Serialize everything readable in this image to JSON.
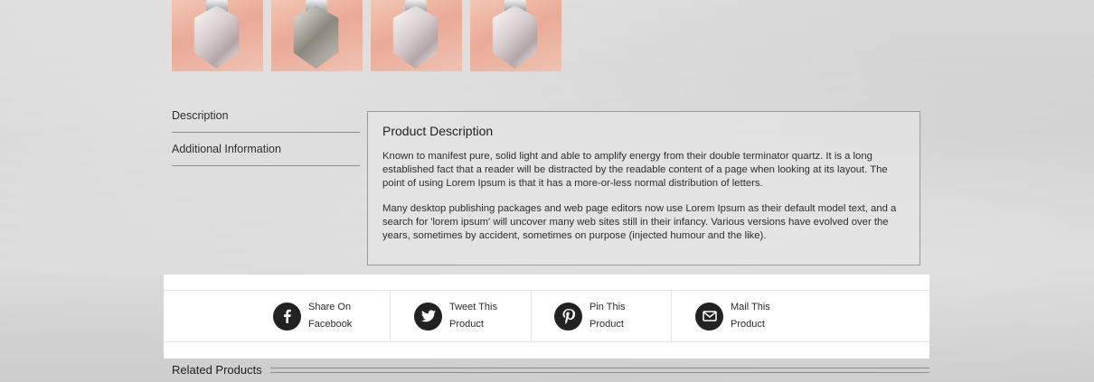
{
  "tabs": {
    "description": "Description",
    "additional_info": "Additional Information"
  },
  "product_description": {
    "heading": "Product Description",
    "paragraph_1": "Known to manifest pure, solid light and able to amplify energy from their double terminator quartz. It is a long established fact that a reader will be distracted by the readable content of a page when looking at its layout. The point of using Lorem Ipsum is that it has a more-or-less normal distribution of letters.",
    "paragraph_2": "Many desktop publishing packages and web page editors now use Lorem Ipsum as their default model text, and a search for 'lorem ipsum' will uncover many web sites still in their infancy. Various versions have evolved over the years, sometimes by accident, sometimes on purpose (injected humour and the like)."
  },
  "share": {
    "facebook": {
      "line1": "Share On",
      "line2": "Facebook",
      "icon": "facebook-icon"
    },
    "twitter": {
      "line1": "Tweet This",
      "line2": "Product",
      "icon": "twitter-icon"
    },
    "pinterest": {
      "line1": "Pin This",
      "line2": "Product",
      "icon": "pinterest-icon"
    },
    "mail": {
      "line1": "Mail This",
      "line2": "Product",
      "icon": "mail-icon"
    }
  },
  "related": {
    "title": "Related Products"
  }
}
